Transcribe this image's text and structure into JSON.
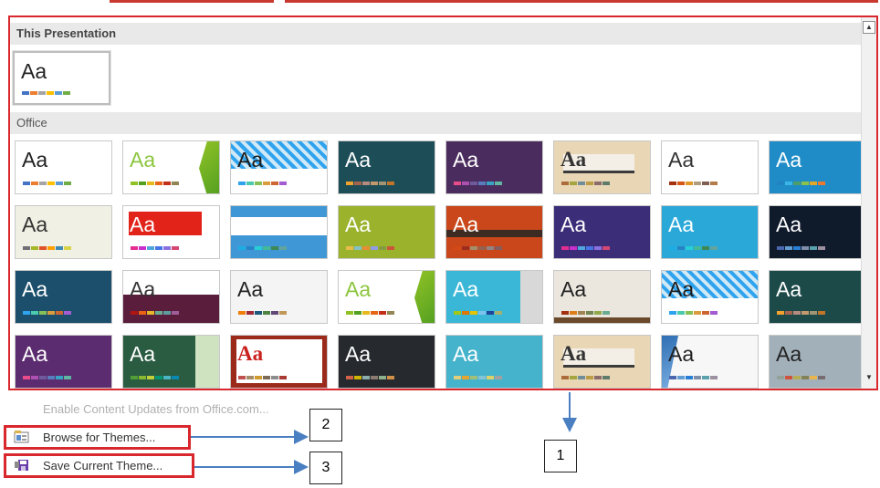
{
  "gallery": {
    "this_presentation_header": "This Presentation",
    "office_header": "Office",
    "current_theme": {
      "label": "Aa",
      "bg": "#ffffff",
      "fg": "#222222",
      "swatches": [
        "#4472c4",
        "#ed7d31",
        "#a5a5a5",
        "#ffc000",
        "#5b9bd5",
        "#70ad47"
      ]
    },
    "themes": [
      {
        "label": "Aa",
        "bg": "#ffffff",
        "fg": "#222222",
        "style": "plain",
        "swatches": [
          "#4472c4",
          "#ed7d31",
          "#a5a5a5",
          "#ffc000",
          "#5b9bd5",
          "#70ad47"
        ]
      },
      {
        "label": "Aa",
        "bg": "#ffffff",
        "fg": "#8cc63e",
        "style": "facet",
        "swatches": [
          "#90c226",
          "#54a021",
          "#e6b91e",
          "#e76618",
          "#c42f1a",
          "#918655"
        ]
      },
      {
        "label": "Aa",
        "bg": "#2e8fb8",
        "fg": "#1b1b1b",
        "style": "pattern",
        "swatches": [
          "#2fa3ee",
          "#4bcaad",
          "#86c157",
          "#d99c3f",
          "#ce6633",
          "#a35dd1"
        ]
      },
      {
        "label": "Aa",
        "bg": "#1d4e57",
        "fg": "#ffffff",
        "style": "dark",
        "swatches": [
          "#f0a22e",
          "#a5644e",
          "#b58b80",
          "#c3986d",
          "#a19574",
          "#c17529"
        ]
      },
      {
        "label": "Aa",
        "bg": "#4b2c5e",
        "fg": "#ffffff",
        "style": "dark",
        "swatches": [
          "#e84c8b",
          "#ae4fb2",
          "#6f5a9e",
          "#5a7cbd",
          "#3aa3c4",
          "#61b6a1"
        ]
      },
      {
        "label": "Aa",
        "bg": "#e8d6b5",
        "fg": "#333333",
        "style": "band",
        "swatches": [
          "#ab6b3b",
          "#a5a53f",
          "#718c9a",
          "#bc9d45",
          "#8c6b6b",
          "#5d7a6b"
        ]
      },
      {
        "label": "Aa",
        "bg": "#ffffff",
        "fg": "#333333",
        "style": "plain",
        "swatches": [
          "#a5300f",
          "#d55816",
          "#e19825",
          "#b19c7d",
          "#7f5f52",
          "#b27d49"
        ]
      },
      {
        "label": "Aa",
        "bg": "#1f8cc7",
        "fg": "#ffffff",
        "style": "dark",
        "swatches": [
          "#2283c3",
          "#39b5e6",
          "#4e9e69",
          "#8ac34a",
          "#e3a829",
          "#eb7931"
        ]
      },
      {
        "label": "Aa",
        "bg": "#f0f0e4",
        "fg": "#333333",
        "style": "plain",
        "swatches": [
          "#6f6f74",
          "#a6b727",
          "#df5327",
          "#fe9e00",
          "#418ab3",
          "#d7d447"
        ]
      },
      {
        "label": "Aa",
        "bg": "#ffffff",
        "fg": "#ffffff",
        "style": "redbar",
        "swatches": [
          "#e32d91",
          "#c830cc",
          "#4ea6dc",
          "#4775e7",
          "#8971e1",
          "#d54773"
        ]
      },
      {
        "label": "Aa",
        "bg": "#3f97d5",
        "fg": "#ffffff",
        "style": "bluestripe",
        "swatches": [
          "#1cade4",
          "#2683c6",
          "#27ced7",
          "#42ba97",
          "#3e8853",
          "#62a39f"
        ]
      },
      {
        "label": "Aa",
        "bg": "#9ab22c",
        "fg": "#ffffff",
        "style": "dark",
        "swatches": [
          "#e8bc4a",
          "#83c1c6",
          "#e78d35",
          "#909ce1",
          "#839c41",
          "#cc5439"
        ]
      },
      {
        "label": "Aa",
        "bg": "#c9471a",
        "fg": "#ffffff",
        "style": "banded",
        "swatches": [
          "#d34817",
          "#9b2d1f",
          "#a28e6a",
          "#956251",
          "#918485",
          "#855d5d"
        ]
      },
      {
        "label": "Aa",
        "bg": "#3b2d77",
        "fg": "#ffffff",
        "style": "dark",
        "swatches": [
          "#e32d91",
          "#c830cc",
          "#4ea6dc",
          "#4775e7",
          "#8971e1",
          "#d54773"
        ]
      },
      {
        "label": "Aa",
        "bg": "#2aa9d9",
        "fg": "#ffffff",
        "style": "dark",
        "swatches": [
          "#1cade4",
          "#2683c6",
          "#27ced7",
          "#42ba97",
          "#3e8853",
          "#62a39f"
        ]
      },
      {
        "label": "Aa",
        "bg": "#0f1a2b",
        "fg": "#ffffff",
        "style": "dark",
        "swatches": [
          "#4a66ac",
          "#629dd1",
          "#297fd5",
          "#7f8fa9",
          "#5aa2ae",
          "#9d90a0"
        ]
      },
      {
        "label": "Aa",
        "bg": "#1b4f6b",
        "fg": "#ffffff",
        "style": "dark",
        "swatches": [
          "#2fa3ee",
          "#4bcaad",
          "#86c157",
          "#d99c3f",
          "#ce6633",
          "#a35dd1"
        ]
      },
      {
        "label": "Aa",
        "bg": "#ffffff",
        "fg": "#333333",
        "style": "wine",
        "swatches": [
          "#b01513",
          "#ea6312",
          "#e6b729",
          "#6aac90",
          "#5f9c9d",
          "#9e5e9b"
        ]
      },
      {
        "label": "Aa",
        "bg": "#f4f4f4",
        "fg": "#222222",
        "style": "plain",
        "swatches": [
          "#f07f09",
          "#9f2936",
          "#1b587c",
          "#4e8542",
          "#604878",
          "#c19859"
        ]
      },
      {
        "label": "Aa",
        "bg": "#ffffff",
        "fg": "#8cc63e",
        "style": "facet",
        "swatches": [
          "#90c226",
          "#54a021",
          "#e6b91e",
          "#e76618",
          "#c42f1a",
          "#918655"
        ]
      },
      {
        "label": "Aa",
        "bg": "#3ab7d6",
        "fg": "#ffffff",
        "style": "panel",
        "swatches": [
          "#a2c816",
          "#e07602",
          "#e4c402",
          "#7dc1ef",
          "#21449b",
          "#a2b170"
        ]
      },
      {
        "label": "Aa",
        "bg": "#ebe7df",
        "fg": "#222222",
        "style": "floor",
        "swatches": [
          "#a53010",
          "#de7e18",
          "#9f8351",
          "#728653",
          "#92aa4c",
          "#6aac91"
        ]
      },
      {
        "label": "Aa",
        "bg": "#2e8fb8",
        "fg": "#1b1b1b",
        "style": "pattern",
        "swatches": [
          "#2fa3ee",
          "#4bcaad",
          "#86c157",
          "#d99c3f",
          "#ce6633",
          "#a35dd1"
        ]
      },
      {
        "label": "Aa",
        "bg": "#1c4a49",
        "fg": "#ffffff",
        "style": "dark",
        "swatches": [
          "#f0a22e",
          "#a5644e",
          "#b58b80",
          "#c3986d",
          "#a19574",
          "#c17529"
        ]
      },
      {
        "label": "Aa",
        "bg": "#5b2c6f",
        "fg": "#ffffff",
        "style": "dark",
        "swatches": [
          "#e84c8b",
          "#ae4fb2",
          "#6f5a9e",
          "#5a7cbd",
          "#3aa3c4",
          "#61b6a1"
        ]
      },
      {
        "label": "Aa",
        "bg": "#2a5c42",
        "fg": "#ffffff",
        "style": "greenpanel",
        "swatches": [
          "#549e39",
          "#8ab833",
          "#c0cf3a",
          "#029676",
          "#4ab5c4",
          "#0989b1"
        ]
      },
      {
        "label": "Aa",
        "bg": "#9c2a1b",
        "fg": "#c9211e",
        "style": "redframe",
        "swatches": [
          "#c0504d",
          "#a48c6a",
          "#d09a2f",
          "#7d6b58",
          "#8d8d8d",
          "#aa3b34"
        ]
      },
      {
        "label": "Aa",
        "bg": "#262a2e",
        "fg": "#ffffff",
        "style": "dark",
        "swatches": [
          "#d16349",
          "#ccb400",
          "#8cadae",
          "#8c7b70",
          "#8fb08c",
          "#d19049"
        ]
      },
      {
        "label": "Aa",
        "bg": "#46b3cc",
        "fg": "#ffffff",
        "style": "dark",
        "swatches": [
          "#e0cf7a",
          "#e7a42c",
          "#a0c07a",
          "#84c4d7",
          "#dcd26e",
          "#a1a1a1"
        ]
      },
      {
        "label": "Aa",
        "bg": "#e8d6b5",
        "fg": "#333333",
        "style": "band",
        "swatches": [
          "#ab6b3b",
          "#a5a53f",
          "#718c9a",
          "#bc9d45",
          "#8c6b6b",
          "#5d7a6b"
        ]
      },
      {
        "label": "Aa",
        "bg": "#f7f7f7",
        "fg": "#222222",
        "style": "ribbon",
        "swatches": [
          "#4a66ac",
          "#629dd1",
          "#297fd5",
          "#7f8fa9",
          "#5aa2ae",
          "#9d90a0"
        ]
      },
      {
        "label": "Aa",
        "bg": "#a2b0ba",
        "fg": "#222222",
        "style": "plain",
        "swatches": [
          "#93a299",
          "#cf543f",
          "#b5ae53",
          "#848058",
          "#e8b54d",
          "#786c71"
        ]
      }
    ]
  },
  "menu": {
    "enable_updates": "Enable Content Updates from Office.com...",
    "browse": "Browse for Themes...",
    "save": "Save Current Theme..."
  },
  "callouts": {
    "one": "1",
    "two": "2",
    "three": "3"
  },
  "colors": {
    "highlight": "#d9272e",
    "arrow": "#4a7fc1"
  }
}
